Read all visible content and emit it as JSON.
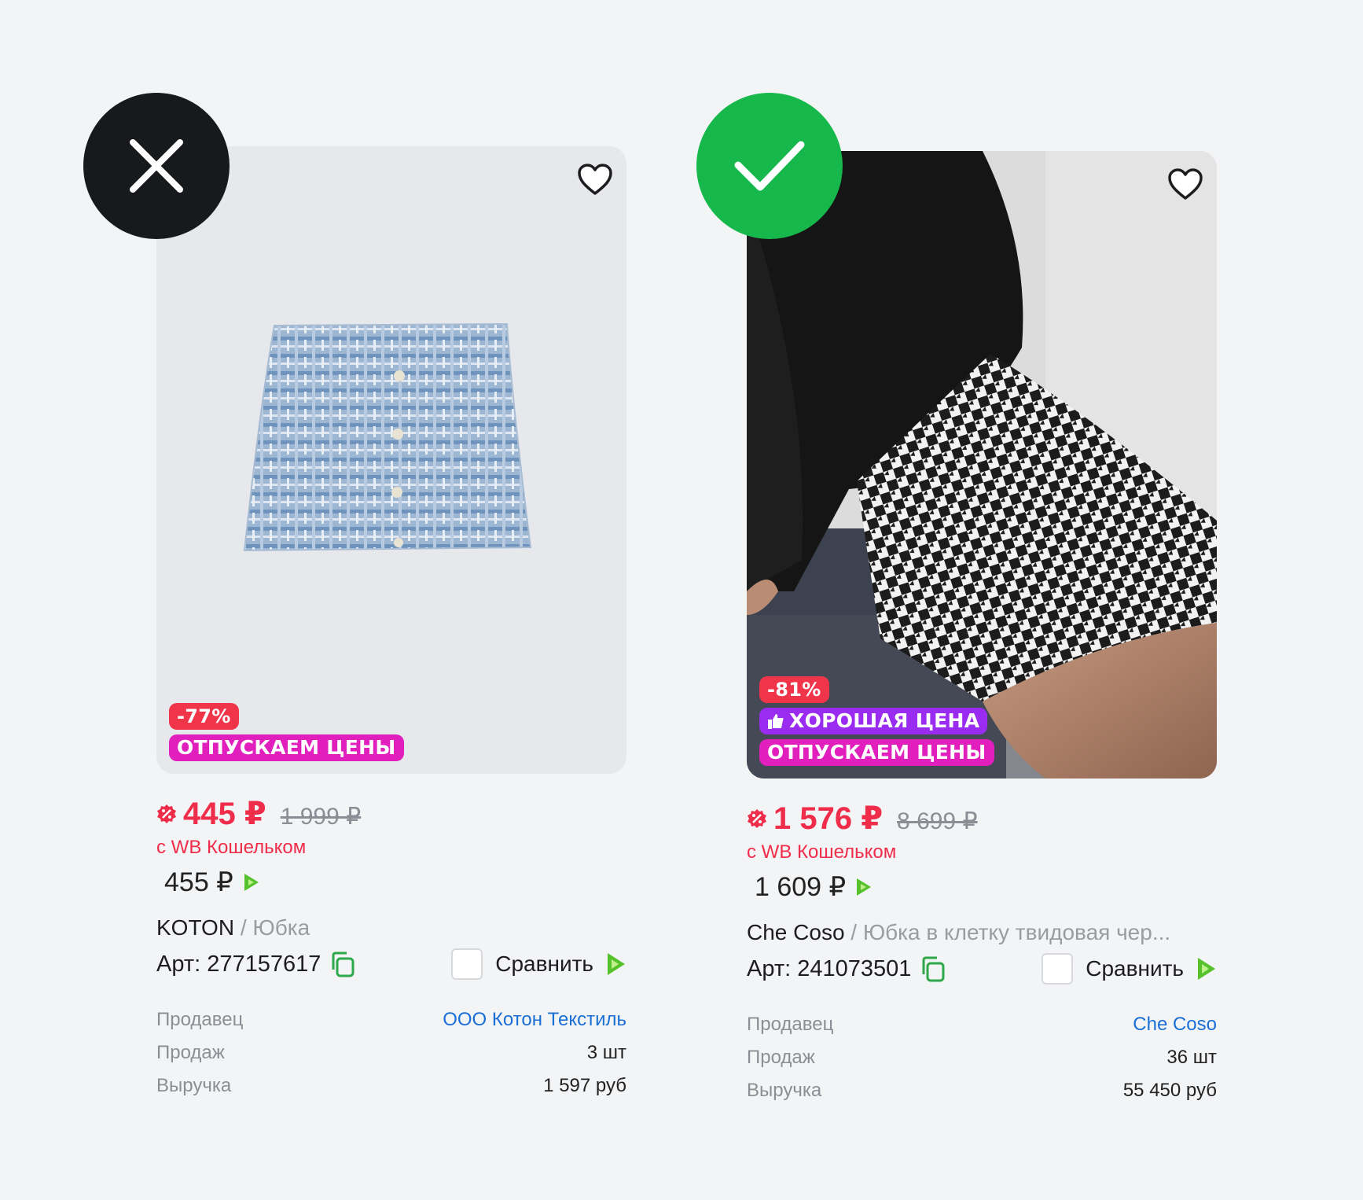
{
  "colors": {
    "accent_red": "#ef2d4a",
    "sale_pink": "#e11fbd",
    "good_purple": "#9a2bf0",
    "link_blue": "#1a6fd6",
    "good_green": "#17b84b",
    "bad_black": "#17191d"
  },
  "cards": [
    {
      "discount": "-77%",
      "good_price": "",
      "sale": "ОТПУСКАЕМ ЦЕНЫ",
      "price": "445 ₽",
      "old_price": "1 999 ₽",
      "wallet": "с WB Кошельком",
      "price_plain": "455 ₽",
      "brand": "KOTON",
      "type": " / Юбка",
      "art": "Арт: 277157617",
      "compare": "Сравнить",
      "seller_label": "Продавец",
      "seller": "ООО Котон Текстиль",
      "sales_label": "Продаж",
      "sales": "3 шт",
      "revenue_label": "Выручка",
      "revenue": "1 597 руб"
    },
    {
      "discount": "-81%",
      "good_price": "ХОРОШАЯ ЦЕНА",
      "sale": "ОТПУСКАЕМ ЦЕНЫ",
      "price": "1 576 ₽",
      "old_price": "8 699 ₽",
      "wallet": "с WB Кошельком",
      "price_plain": "1 609 ₽",
      "brand": "Che Coso",
      "type": " / Юбка в клетку твидовая чер...",
      "art": "Арт: 241073501",
      "compare": "Сравнить",
      "seller_label": "Продавец",
      "seller": "Che Coso",
      "sales_label": "Продаж",
      "sales": "36 шт",
      "revenue_label": "Выручка",
      "revenue": "55 450 руб"
    }
  ],
  "icons": {
    "bad": "close-icon",
    "good": "check-icon",
    "fav": "heart-icon",
    "copy": "copy-icon",
    "coin": "cashback-icon"
  }
}
